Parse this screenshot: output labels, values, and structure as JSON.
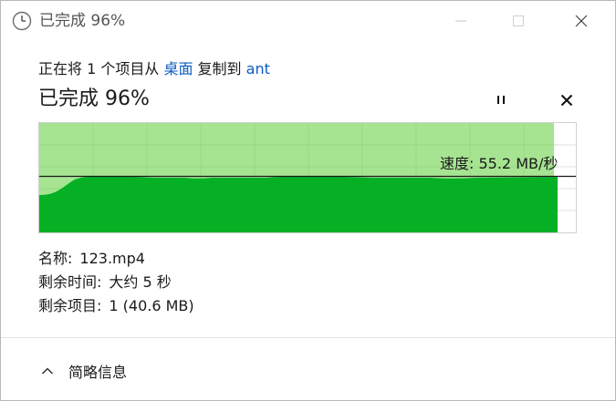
{
  "window": {
    "title": "已完成 96%",
    "icons": {
      "app": "clock-icon",
      "minimize": "minimize-icon",
      "maximize": "maximize-icon",
      "close": "close-icon"
    }
  },
  "copy_line": {
    "prefix": "正在将 1 个项目从 ",
    "source": "桌面",
    "middle": " 复制到 ",
    "destination": "ant"
  },
  "progress": {
    "title": "已完成 96%",
    "percent": 96,
    "pause_icon": "pause-icon",
    "cancel_icon": "cancel-x-icon"
  },
  "speed": {
    "label": "速度: 55.2 MB/秒"
  },
  "details": {
    "name_label": "名称:",
    "name_value": "123.mp4",
    "time_label": "剩余时间:",
    "time_value": "大约 5 秒",
    "items_label": "剩余项目:",
    "items_value": "1 (40.6 MB)"
  },
  "footer": {
    "more_info_label": "简略信息",
    "chevron_icon": "chevron-up-icon"
  },
  "colors": {
    "accent_link": "#0a5bc4",
    "progress_fill_light": "#a6e492",
    "speed_fill": "#06b025",
    "chart_grid": "#c8c8c8"
  }
}
